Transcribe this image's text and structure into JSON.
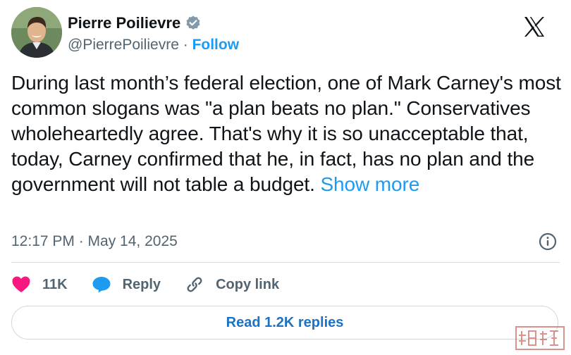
{
  "author": {
    "name": "Pierre Poilievre",
    "handle": "@PierrePoilievre",
    "separator": "·",
    "follow_label": "Follow"
  },
  "tweet": {
    "text": "During last month’s federal election, one of Mark Carney's most common slogans was \"a plan beats no plan.\" Conservatives wholeheartedly agree. That's why it is so unacceptable that, today, Carney confirmed that he, in fact, has no plan and the government will not table a budget.",
    "show_more_label": "Show more",
    "timestamp": "12:17 PM · May 14, 2025"
  },
  "actions": {
    "likes_count": "11K",
    "reply_label": "Reply",
    "copy_link_label": "Copy link"
  },
  "read_replies_label": "Read 1.2K replies",
  "icons": {
    "verified": "verified-badge-icon",
    "platform": "x-logo-icon",
    "info": "info-icon",
    "like": "heart-icon",
    "reply": "speech-bubble-icon",
    "copy_link": "link-icon"
  },
  "colors": {
    "accent": "#1d9bf0",
    "like": "#f91880",
    "muted": "#536471",
    "text": "#0f1419",
    "border": "#cfd9de"
  }
}
